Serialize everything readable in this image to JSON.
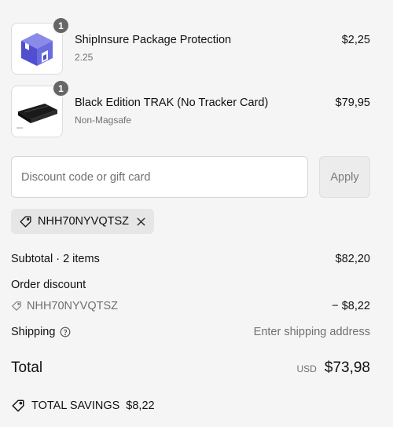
{
  "items": [
    {
      "name": "ShipInsure Package Protection",
      "variant": "2.25",
      "price": "$2,25",
      "quantity": "1",
      "thumbnail_icon": "package-box-icon"
    },
    {
      "name": "Black Edition TRAK (No Tracker Card)",
      "variant": "Non-Magsafe",
      "price": "$79,95",
      "quantity": "1",
      "thumbnail_icon": "black-wallet-product-icon"
    }
  ],
  "discount": {
    "placeholder": "Discount code or gift card",
    "value": "",
    "apply_label": "Apply",
    "applied_code": "NHH70NYVQTSZ"
  },
  "summary": {
    "subtotal_label": "Subtotal · 2 items",
    "subtotal_value": "$82,20",
    "order_discount_label": "Order discount",
    "order_discount_code": "NHH70NYVQTSZ",
    "order_discount_value": "− $8,22",
    "shipping_label": "Shipping",
    "shipping_value": "Enter shipping address",
    "total_label": "Total",
    "total_currency": "USD",
    "total_value": "$73,98",
    "savings_label": "TOTAL SAVINGS",
    "savings_value": "$8,22"
  },
  "colors": {
    "background": "#f5f5f5",
    "badge": "#666666",
    "box_icon": "#5b5bd6",
    "muted_text": "#707070"
  }
}
